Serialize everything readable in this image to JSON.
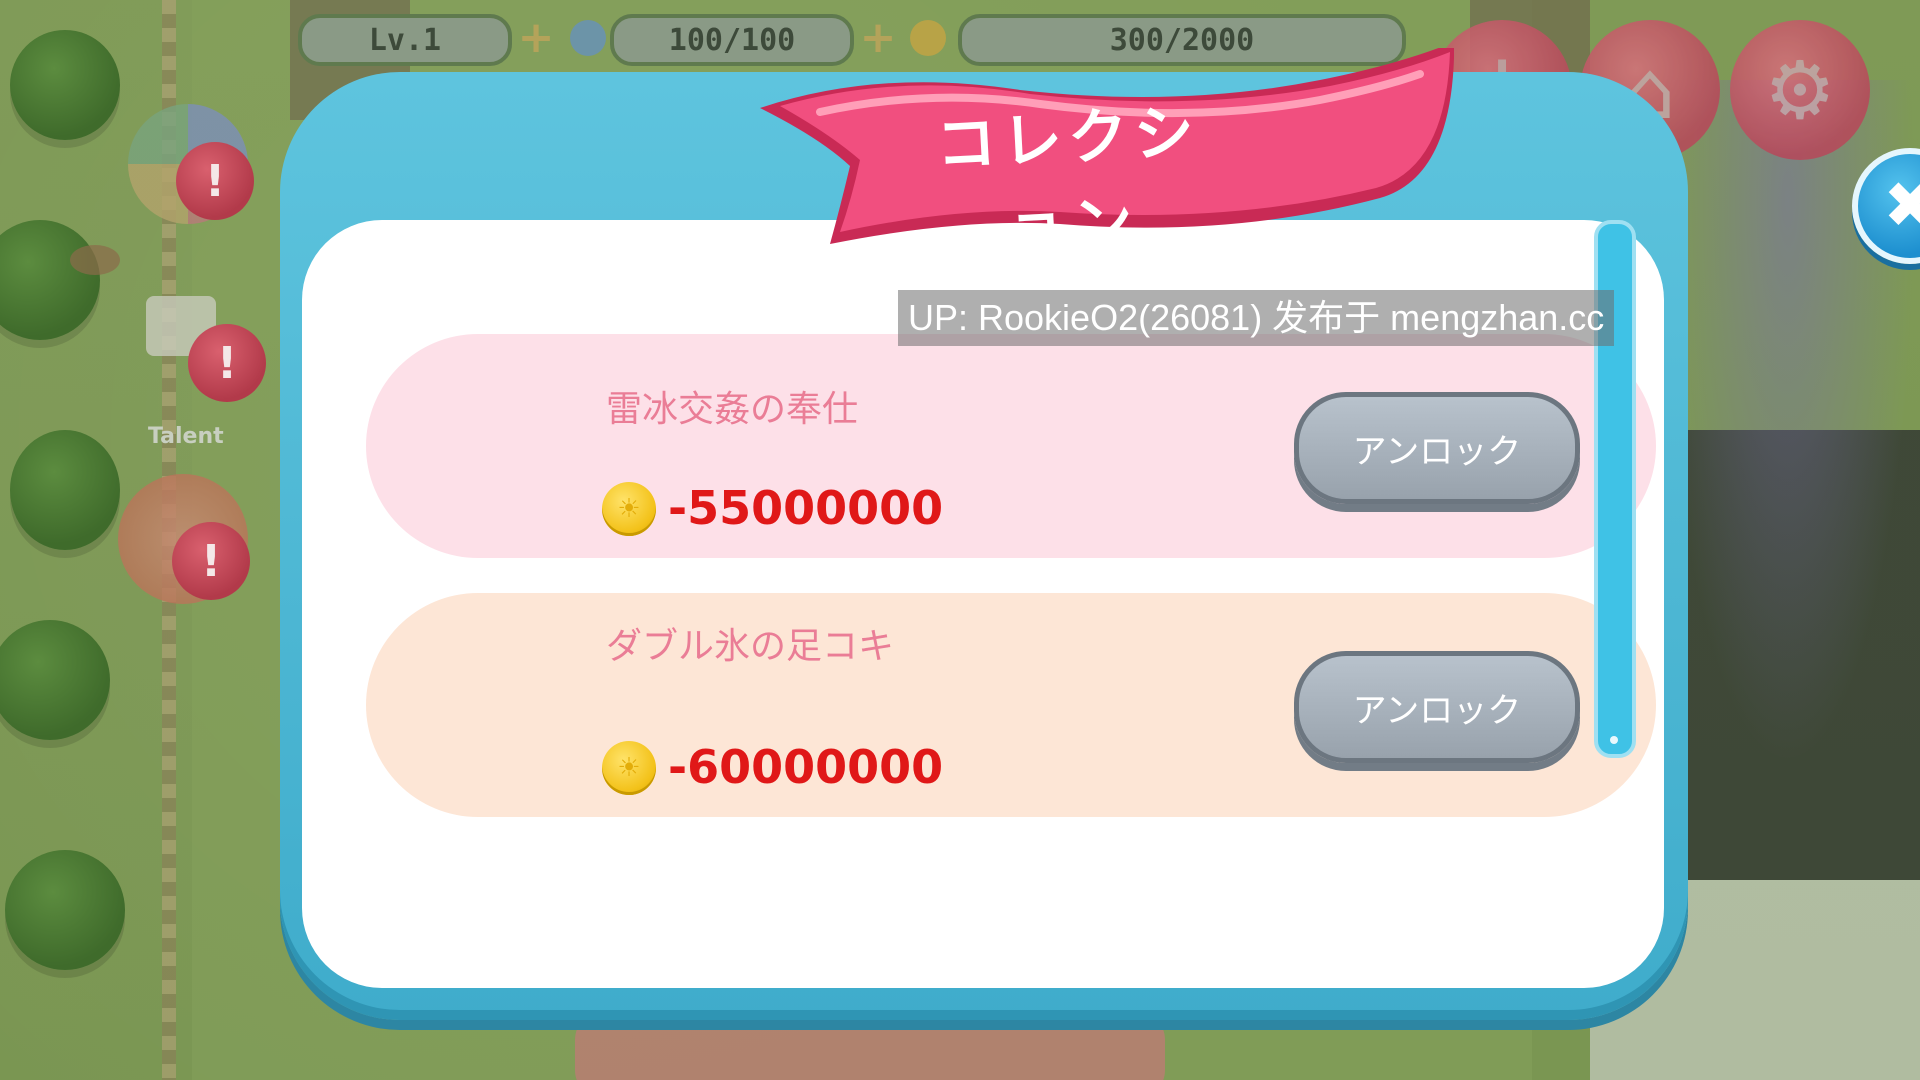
{
  "hud": {
    "level": "Lv.1",
    "stamina": "100/100",
    "coins": "300/2000",
    "talent_label": "Talent"
  },
  "dialog": {
    "title": "コレクション",
    "close_icon": "close-icon",
    "items": [
      {
        "title": "雷冰交姦の奉仕",
        "price": "-55000000",
        "button": "アンロック"
      },
      {
        "title": "ダブル氷の足コキ",
        "price": "-60000000",
        "button": "アンロック"
      }
    ]
  },
  "watermark": "UP: RookieO2(26081) 发布于 mengzhan.cc",
  "colors": {
    "dialog_frame": "#4bb8d7",
    "ribbon": "#f14f7f",
    "price": "#e01818",
    "item_title": "#ea7d96"
  }
}
